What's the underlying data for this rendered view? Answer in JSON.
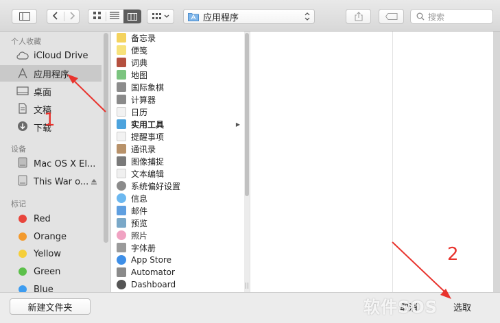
{
  "toolbar": {
    "path": "应用程序",
    "search_placeholder": "搜索"
  },
  "sidebar": {
    "favorites_label": "个人收藏",
    "favorites": [
      {
        "label": "iCloud Drive",
        "icon": "cloud-icon"
      },
      {
        "label": "应用程序",
        "icon": "applications-icon",
        "selected": true
      },
      {
        "label": "桌面",
        "icon": "desktop-icon"
      },
      {
        "label": "文稿",
        "icon": "documents-icon"
      },
      {
        "label": "下载",
        "icon": "download-icon"
      }
    ],
    "devices_label": "设备",
    "devices": [
      {
        "label": "Mac OS X El...",
        "icon": "disk-icon"
      },
      {
        "label": "This War o...",
        "icon": "disk-icon",
        "eject": true
      }
    ],
    "tags_label": "标记",
    "tags": [
      {
        "label": "Red",
        "color": "#e8453c"
      },
      {
        "label": "Orange",
        "color": "#f39a2d"
      },
      {
        "label": "Yellow",
        "color": "#f5cf3a"
      },
      {
        "label": "Green",
        "color": "#5cc04a"
      },
      {
        "label": "Blue",
        "color": "#3d9cf0"
      }
    ]
  },
  "apps": [
    {
      "label": "备忘录",
      "color": "#f4d35e"
    },
    {
      "label": "便笺",
      "color": "#f7e27a"
    },
    {
      "label": "词典",
      "color": "#b5503f"
    },
    {
      "label": "地图",
      "color": "#7bc47f"
    },
    {
      "label": "国际象棋",
      "color": "#8c8c8c"
    },
    {
      "label": "计算器",
      "color": "#8a8a8a"
    },
    {
      "label": "日历",
      "color": "#f2f2f2"
    },
    {
      "label": "实用工具",
      "color": "#4ca3dd",
      "folder": true
    },
    {
      "label": "提醒事项",
      "color": "#f2f2f2"
    },
    {
      "label": "通讯录",
      "color": "#b8926a"
    },
    {
      "label": "图像捕捉",
      "color": "#7a7a7a"
    },
    {
      "label": "文本编辑",
      "color": "#f0f0f0"
    },
    {
      "label": "系统偏好设置",
      "color": "#8b8b8b"
    },
    {
      "label": "信息",
      "color": "#6cb8f0"
    },
    {
      "label": "邮件",
      "color": "#5f9fe0"
    },
    {
      "label": "预览",
      "color": "#7aa8c8"
    },
    {
      "label": "照片",
      "color": "#f0a2c2"
    },
    {
      "label": "字体册",
      "color": "#9a9a9a"
    },
    {
      "label": "App Store",
      "color": "#3e8fe8"
    },
    {
      "label": "Automator",
      "color": "#8a8a8a"
    },
    {
      "label": "Dashboard",
      "color": "#555555"
    }
  ],
  "bottom": {
    "new_folder": "新建文件夹",
    "cancel": "取消",
    "choose": "选取"
  },
  "annotations": {
    "step1": "1",
    "step2": "2",
    "watermark": "软件SOS"
  }
}
